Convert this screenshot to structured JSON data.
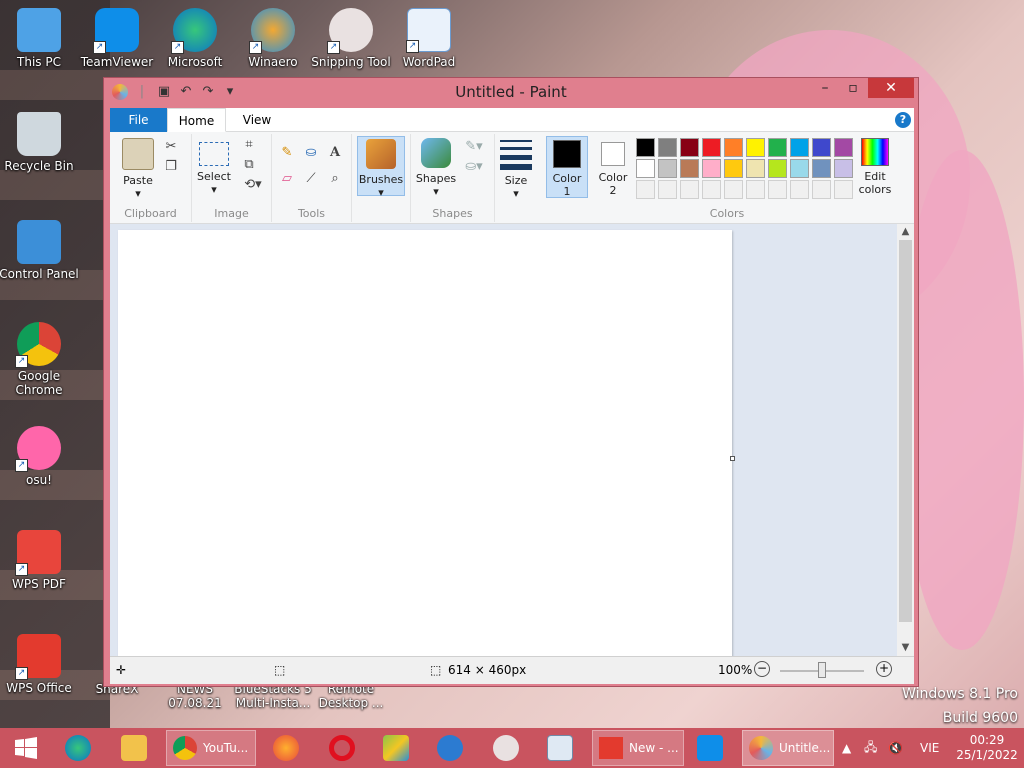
{
  "desktop": {
    "icons": [
      {
        "label": "This PC"
      },
      {
        "label": "TeamViewer"
      },
      {
        "label": "Microsoft"
      },
      {
        "label": "Winaero"
      },
      {
        "label": "Snipping Tool"
      },
      {
        "label": "WordPad"
      },
      {
        "label": "Recycle Bin"
      },
      {
        "label": "Control Panel"
      },
      {
        "label": "Google Chrome"
      },
      {
        "label": "osu!"
      },
      {
        "label": "WPS PDF"
      },
      {
        "label": "WPS Office"
      },
      {
        "label": "ShareX"
      },
      {
        "label": "NEWS 07.08.21"
      },
      {
        "label": "BlueStacks 5 Multi-Insta..."
      },
      {
        "label": "Remote Desktop ..."
      }
    ],
    "watermark_line1": "Windows 8.1 Pro",
    "watermark_line2": "Build 9600"
  },
  "paint": {
    "title": "Untitled - Paint",
    "tabs": {
      "file": "File",
      "home": "Home",
      "view": "View"
    },
    "help": "?",
    "ribbon": {
      "clipboard": {
        "label": "Clipboard",
        "paste": "Paste"
      },
      "image": {
        "label": "Image",
        "select": "Select"
      },
      "tools": {
        "label": "Tools"
      },
      "brushes": "Brushes",
      "shapes": {
        "label": "Shapes",
        "button": "Shapes"
      },
      "size": "Size",
      "color1": "Color 1",
      "color2": "Color 2",
      "colors_label": "Colors",
      "edit_colors": "Edit colors"
    },
    "palette_row1": [
      "#000000",
      "#7f7f7f",
      "#880015",
      "#ed1c24",
      "#ff7f27",
      "#fff200",
      "#22b14c",
      "#00a2e8",
      "#3f48cc",
      "#a349a4"
    ],
    "palette_row2": [
      "#ffffff",
      "#c3c3c3",
      "#b97a57",
      "#ffaec9",
      "#ffc90e",
      "#efe4b0",
      "#b5e61d",
      "#99d9ea",
      "#7092be",
      "#c8bfe7"
    ],
    "status": {
      "dimensions": "614 × 460px",
      "zoom": "100%"
    }
  },
  "taskbar": {
    "youtube": "YouTu...",
    "wps_new": "New - ...",
    "paint": "Untitle...",
    "lang": "VIE",
    "time": "00:29",
    "date": "25/1/2022"
  }
}
